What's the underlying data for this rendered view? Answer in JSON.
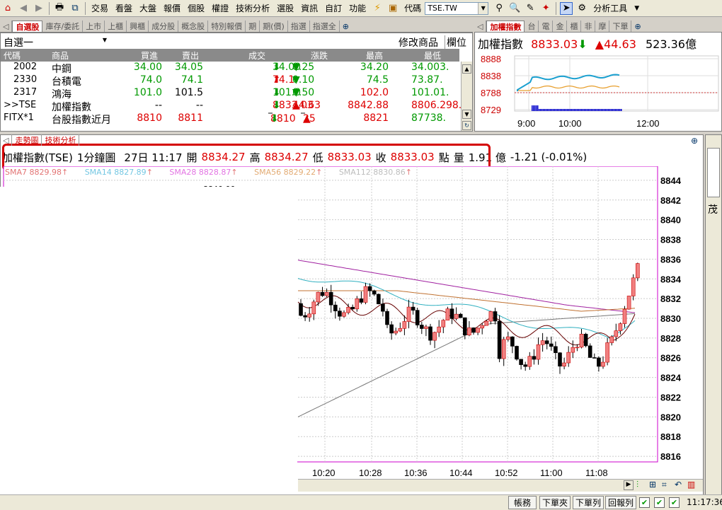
{
  "toolbar": {
    "menus": [
      "交易",
      "看盤",
      "大盤",
      "報價",
      "個股",
      "權證",
      "技術分析",
      "選股",
      "資訊",
      "自訂",
      "功能"
    ],
    "symbol_label": "代碼",
    "symbol_value": "TSE.TW",
    "tools_label": "分析工具"
  },
  "watch_tabs": [
    "自選股",
    "庫存/委託",
    "上市",
    "上櫃",
    "興櫃",
    "成分股",
    "概念股",
    "特別報價",
    "期",
    "期(價)",
    "指選",
    "指選全"
  ],
  "watch": {
    "list_name": "自選一",
    "edit_label": "修改商品",
    "field_label": "欄位",
    "columns": [
      "代碼",
      "商品",
      "買進",
      "賣出",
      "成交",
      "漲跌",
      "最高",
      "最低"
    ],
    "rows": [
      {
        "code": "2002",
        "name": "中鋼",
        "bid": "34.00",
        "ask": "34.05",
        "last": "34.00",
        "chg": "0.25",
        "high": "34.20",
        "low": "34.003."
      },
      {
        "code": "2330",
        "name": "台積電",
        "bid": "74.0",
        "ask": "74.1",
        "last": "74.1",
        "chg": "0.10",
        "high": "74.5",
        "low": "73.87."
      },
      {
        "code": "2317",
        "name": "鴻海",
        "bid": "101.0",
        "ask": "101.5",
        "last": "101.0",
        "chg": "0.50",
        "high": "102.0",
        "low": "101.01."
      },
      {
        "code": ">>TSE",
        "name": "加權指數",
        "bid": "--",
        "ask": "--",
        "last": "8833.03",
        "chg": "44.63",
        "high": "8842.88",
        "low": "8806.298."
      },
      {
        "code": "FITX*1",
        "name": "台股指數近月",
        "bid": "8810",
        "ask": "8811",
        "last": "8810",
        "chg": "25",
        "high": "8821",
        "low": "87738."
      }
    ]
  },
  "index_tabs": [
    "加權指數",
    "台",
    "電",
    "金",
    "櫃",
    "非",
    "摩",
    "下單"
  ],
  "index": {
    "name": "加權指數",
    "value": "8833.03",
    "change": "44.63",
    "volume": "523.36億",
    "y_ticks": [
      "8888",
      "8838",
      "8788",
      "8729"
    ],
    "x_ticks": [
      "9:00",
      "10:00",
      "12:00"
    ]
  },
  "chart_tabs": [
    "走勢圖",
    "技術分析"
  ],
  "chart_info": {
    "name": "加權指數(TSE)",
    "period": "1分鐘圖",
    "datetime": "27日 11:17",
    "open_label": "開",
    "open": "8834.27",
    "high_label": "高",
    "high": "8834.27",
    "low_label": "低",
    "low": "8833.03",
    "close_label": "收",
    "close": "8833.03",
    "unit": "點",
    "vol_label": "量",
    "vol": "1.91 億",
    "change": "-1.21 (-0.01%)"
  },
  "sma_legend": [
    "SMA7 8829.98",
    "SMA14 8827.89",
    "SMA28 8828.87",
    "SMA56 8829.22",
    "SMA112 8830.86"
  ],
  "partial_label": "8840.00",
  "right_strip_text": "茂",
  "chart_data": {
    "type": "candlestick",
    "y_ticks": [
      "8844",
      "8842",
      "8840",
      "8838",
      "8836",
      "8834",
      "8832",
      "8830",
      "8828",
      "8826",
      "8824",
      "8822",
      "8820",
      "8818",
      "8816"
    ],
    "x_ticks": [
      "10:20",
      "10:28",
      "10:36",
      "10:44",
      "10:52",
      "11:00",
      "11:08"
    ],
    "ylim": [
      8815,
      8845
    ]
  },
  "status": {
    "buttons": [
      "帳務",
      "下單夾",
      "下單列",
      "回報列"
    ],
    "time": "11:17:36"
  }
}
